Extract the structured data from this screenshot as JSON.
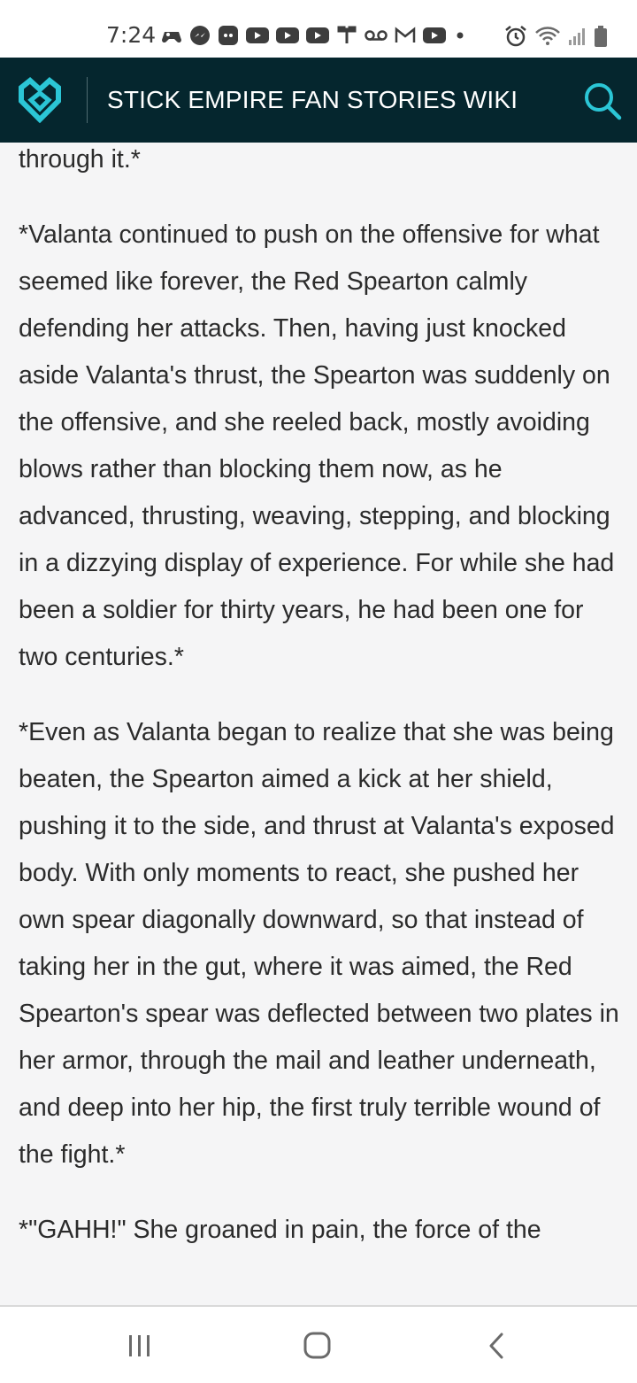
{
  "status_bar": {
    "time": "7:24",
    "notification_icons": [
      "game-controller-icon",
      "messenger-icon",
      "discord-icon",
      "youtube-icon",
      "youtube-icon",
      "youtube-icon",
      "antenna-icon",
      "voicemail-icon",
      "gmail-icon",
      "youtube-icon",
      "more-dot-icon"
    ],
    "system_icons": [
      "alarm-icon",
      "wifi-icon",
      "signal-icon",
      "battery-icon"
    ]
  },
  "header": {
    "title": "STICK EMPIRE FAN STORIES WIKI",
    "accent_color": "#2bc6d6",
    "background_color": "#05262e"
  },
  "article": {
    "paragraphs": [
      "through it.*",
      "*Valanta continued to push on the offensive for what seemed like forever, the Red Spearton calmly defending her attacks. Then, having just knocked aside Valanta's thrust, the Spearton was suddenly on the offensive, and she reeled back, mostly avoiding blows rather than blocking them now, as he advanced, thrusting, weaving, stepping, and blocking in a dizzying display of experience. For while she had been a soldier for thirty years, he had been one for two centuries.*",
      "*Even as Valanta began to realize that she was being beaten, the Spearton aimed a kick at her shield, pushing it to the side, and thrust at Valanta's exposed body. With only moments to react, she pushed her own spear diagonally downward, so that instead of taking her in the gut, where it was aimed, the Red Spearton's spear was deflected between two plates in her armor, through the mail and leather underneath, and deep into her hip, the first truly terrible wound of the fight.*",
      "*\"GAHH!\" She groaned in pain, the force of the"
    ]
  },
  "nav_bar": {
    "buttons": [
      "recent-apps",
      "home",
      "back"
    ]
  }
}
